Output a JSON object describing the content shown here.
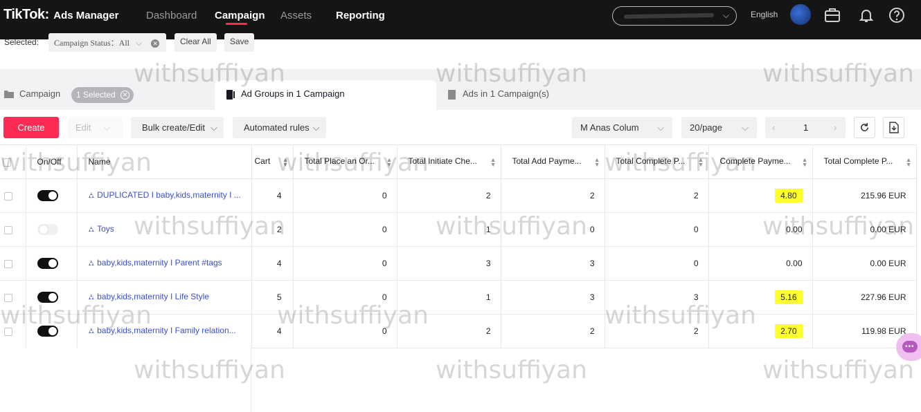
{
  "header": {
    "brand": "TikTok",
    "brand_suffix": ":",
    "product": "Ads Manager",
    "nav": [
      "Dashboard",
      "Campaign",
      "Assets",
      "Reporting"
    ],
    "language": "English"
  },
  "filters": {
    "selected_label": "Selected:",
    "chip_label": "Campaign Status：All",
    "clear_all": "Clear All",
    "save": "Save"
  },
  "tabs": {
    "campaign": "Campaign",
    "campaign_chip": "1 Selected",
    "ad_groups": "Ad Groups in 1 Campaign",
    "ads": "Ads in 1 Campaign(s)"
  },
  "toolbar": {
    "create": "Create",
    "edit": "Edit",
    "bulk": "Bulk create/Edit",
    "automated_rules": "Automated rules",
    "columns_select": "M Anas Colum",
    "page_size": "20/page",
    "page_current": "1",
    "prev": "‹",
    "next": "›"
  },
  "table": {
    "headers": [
      "On/Off",
      "Name",
      "Cart",
      "Total Place an Or...",
      "Total Initiate Che...",
      "Total Add Payme...",
      "Total Complete P...",
      "Complete Payme...",
      "Total Complete P..."
    ],
    "rows": [
      {
        "on": true,
        "name": "DUPLICATED I baby,kids,maternity I ...",
        "cart": "4",
        "place_order": "0",
        "initiate_checkout": "2",
        "add_payment": "2",
        "complete_payment": "2",
        "complete_payment_rate": "4.80",
        "complete_payment_value": "215.96 EUR",
        "highlight": true
      },
      {
        "on": false,
        "name": "Toys",
        "cart": "2",
        "place_order": "0",
        "initiate_checkout": "1",
        "add_payment": "0",
        "complete_payment": "0",
        "complete_payment_rate": "0.00",
        "complete_payment_value": "0.00 EUR",
        "highlight": false
      },
      {
        "on": true,
        "name": "baby,kids,maternity I Parent #tags",
        "cart": "4",
        "place_order": "0",
        "initiate_checkout": "3",
        "add_payment": "3",
        "complete_payment": "0",
        "complete_payment_rate": "0.00",
        "complete_payment_value": "0.00 EUR",
        "highlight": false
      },
      {
        "on": true,
        "name": "baby,kids,maternity I Life Style",
        "cart": "5",
        "place_order": "0",
        "initiate_checkout": "1",
        "add_payment": "3",
        "complete_payment": "3",
        "complete_payment_rate": "5.16",
        "complete_payment_value": "227.96 EUR",
        "highlight": true
      },
      {
        "on": true,
        "name": "baby,kids,maternity I Family relation...",
        "cart": "4",
        "place_order": "0",
        "initiate_checkout": "2",
        "add_payment": "2",
        "complete_payment": "2",
        "complete_payment_rate": "2.70",
        "complete_payment_value": "119.98 EUR",
        "highlight": true
      }
    ]
  },
  "watermark": "withsuffiyan",
  "colors": {
    "brand": "#fe2c55",
    "topbar": "#151515",
    "link": "#3a4fd0",
    "highlight": "#ffff2e"
  }
}
